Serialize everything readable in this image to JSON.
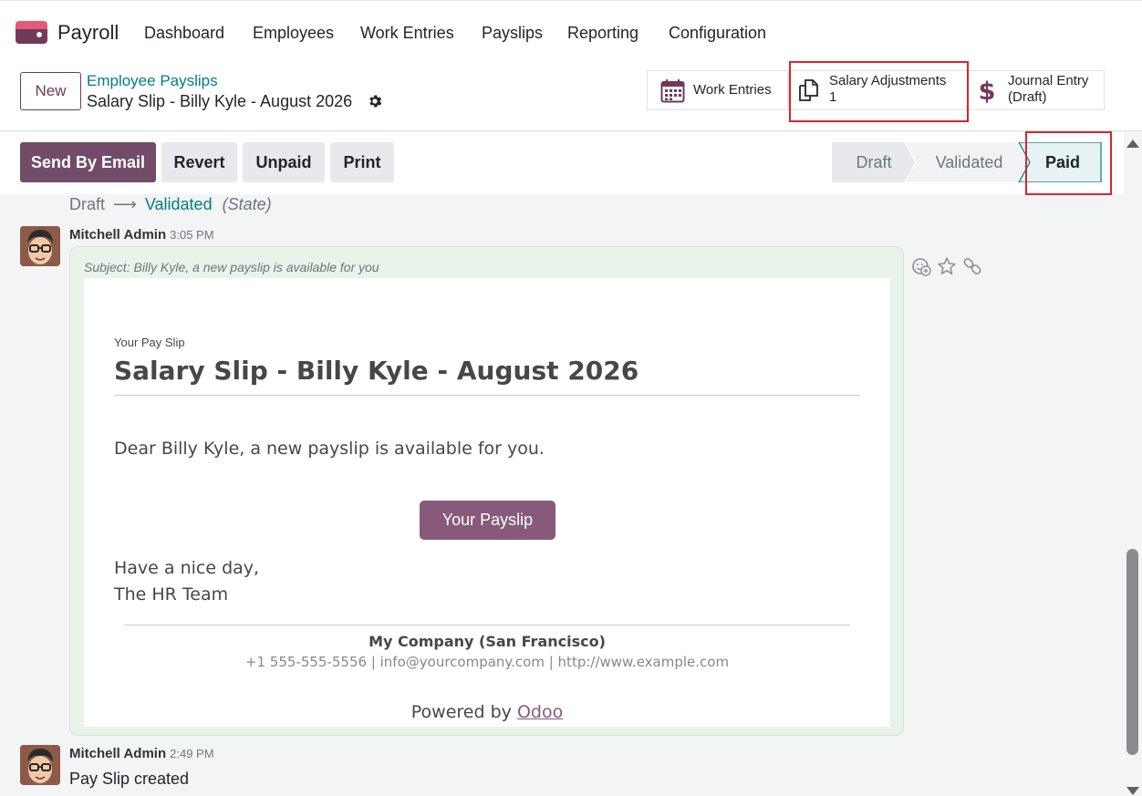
{
  "app": {
    "name": "Payroll",
    "logo_icon": "payroll-app-icon"
  },
  "nav": [
    "Dashboard",
    "Employees",
    "Work Entries",
    "Payslips",
    "Reporting",
    "Configuration"
  ],
  "control": {
    "new_label": "New",
    "breadcrumb": "Employee Payslips",
    "record_title": "Salary Slip - Billy Kyle - August 2026",
    "smart_buttons": {
      "work_entries": {
        "label": "Work Entries",
        "icon": "calendar-icon"
      },
      "salary_adjustments": {
        "label": "Salary Adjustments",
        "count": "1",
        "icon": "documents-icon"
      },
      "journal_entry": {
        "label": "Journal Entry",
        "sub": "(Draft)",
        "icon": "dollar-icon"
      }
    }
  },
  "actions": [
    "Send By Email",
    "Revert",
    "Unpaid",
    "Print"
  ],
  "stages": {
    "items": [
      "Draft",
      "Validated",
      "Paid"
    ],
    "active": "Paid"
  },
  "tracking": {
    "from": "Draft",
    "to": "Validated",
    "field": "(State)"
  },
  "messages": [
    {
      "author": "Mitchell Admin",
      "time": "3:05 PM",
      "subject": "Subject: Billy Kyle, a new payslip is available for you",
      "email": {
        "tag": "Your Pay Slip",
        "title": "Salary Slip - Billy Kyle - August 2026",
        "greeting": "Dear Billy Kyle, a new payslip is available for you.",
        "button": "Your Payslip",
        "closing_1": "Have a nice day,",
        "closing_2": "The HR Team",
        "company": "My Company (San Francisco)",
        "contact": "+1 555-555-5556 | info@yourcompany.com | http://www.example.com",
        "powered_prefix": "Powered by ",
        "powered_link": "Odoo"
      }
    },
    {
      "author": "Mitchell Admin",
      "time": "2:49 PM",
      "body": "Pay Slip created"
    }
  ],
  "colors": {
    "brand": "#714b67",
    "link": "#017e84",
    "highlight": "#d9262c"
  }
}
